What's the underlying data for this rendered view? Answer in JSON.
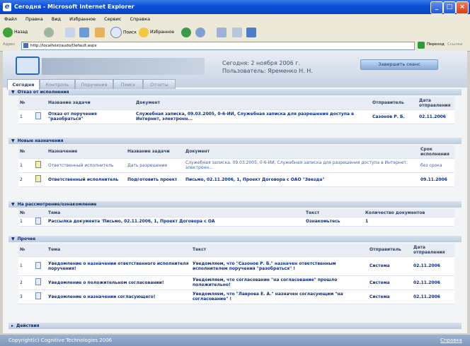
{
  "window": {
    "title": "Сегодня - Microsoft Internet Explorer"
  },
  "menu": [
    "Файл",
    "Правка",
    "Вид",
    "Избранное",
    "Сервис",
    "Справка"
  ],
  "toolbar": {
    "back": "Назад",
    "search": "Поиск",
    "favorites": "Избранное"
  },
  "address": {
    "label": "Адрес",
    "url": "http://localhost/audo/Default.aspx",
    "go": "Переход",
    "links": "Ссылки"
  },
  "header": {
    "today": "Сегодня: 2 ноября 2006 г.",
    "user": "Пользователь: Яременко Н. Н.",
    "end_session": "Завершить сеанс"
  },
  "tabs": [
    "Сегодня",
    "Контроль",
    "Поручения",
    "Поиск",
    "Отчеты"
  ],
  "sec1": {
    "title": "Отказ от исполнения",
    "cols": [
      "№",
      "Название задачи",
      "Документ",
      "Отправитель",
      "Дата отправления"
    ],
    "rows": [
      [
        "1",
        "Отказ от поручения \"разобраться\"",
        "Служебная записка, 09.03.2005, 0-6-ИИ, Служебная записка для разрешения доступа в Интернет, электронн...",
        "Сазонов Р. Б.",
        "02.11.2006"
      ]
    ]
  },
  "sec2": {
    "title": "Новые назначения",
    "cols": [
      "№",
      "Назначение",
      "Название задачи",
      "Документ",
      "Срок исполнения"
    ],
    "rows": [
      [
        "1",
        "Ответственный исполнитель",
        "Дать разрешение",
        "Служебная записка, 09.03.2005, 0-6-ИИ, Служебная записка для разрешения доступа в Интернет, электронн...",
        "без срока"
      ],
      [
        "2",
        "Ответственный исполнитель",
        "Подготовить проект",
        "Письмо, 02.11.2006, 1, Проект Договора с ОАО \"Звезда\"",
        "09.11.2006"
      ]
    ]
  },
  "sec3": {
    "title": "На рассмотрение/ознакомление",
    "cols": [
      "№",
      "Тема",
      "Текст",
      "Количество документов"
    ],
    "rows": [
      [
        "1",
        "Рассылка документа 'Письмо, 02.11.2006, 1, Проект Договора с ОА",
        "Ознакомьтесь",
        "1"
      ]
    ]
  },
  "sec4": {
    "title": "Прочее",
    "cols": [
      "№",
      "Тема",
      "Текст",
      "Отправитель",
      "Дата отправления"
    ],
    "rows": [
      [
        "1",
        "Уведомление о назначении ответственного исполнителя поручения!",
        "Уведомляем, что \"Сазонов Р. Б.\" назначен ответственным исполнителем поручения \"разобраться\" !",
        "Система",
        "02.11.2006"
      ],
      [
        "2",
        "Уведомление о положительном согласовании!",
        "Уведомляем, что согласование \"на согласование\" прошло положительно!",
        "Система",
        "02.11.2006"
      ],
      [
        "3",
        "Уведомление о назначении согласующего!",
        "Уведомляем, что \"Лаврова Е. А.\" назначен согласующим \"на согласование\" !",
        "Система",
        "02.11.2006"
      ]
    ]
  },
  "sec5": {
    "title": "Действия"
  },
  "footer": {
    "copyright": "Copyright(c) Cognitive Technologies 2006",
    "help": "Справка"
  }
}
